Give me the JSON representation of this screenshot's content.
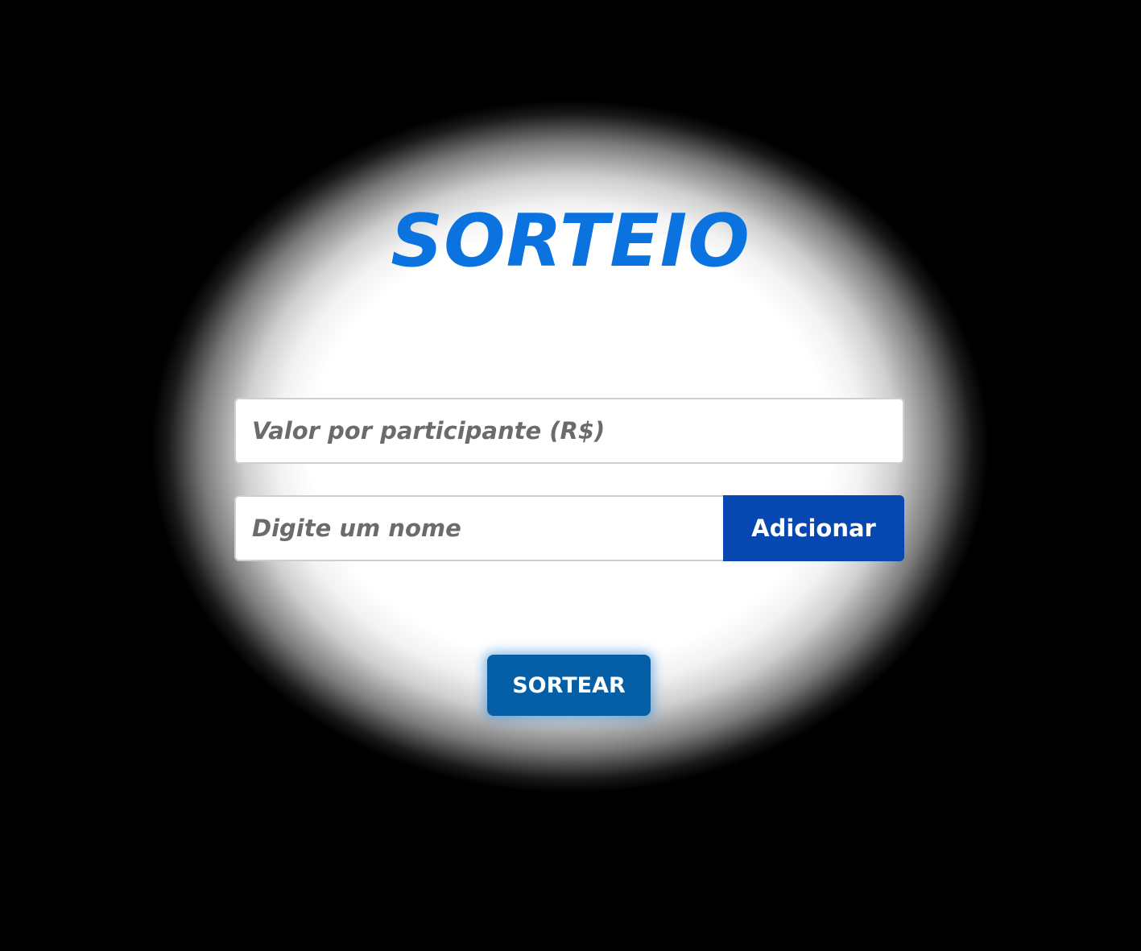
{
  "title": "SORTEIO",
  "form": {
    "valor_placeholder": "Valor por participante (R$)",
    "valor_value": "",
    "nome_placeholder": "Digite um nome",
    "nome_value": "",
    "add_label": "Adicionar"
  },
  "draw_label": "SORTEAR",
  "colors": {
    "title": "#0a73e0",
    "add_button": "#0648b0",
    "draw_button": "#045fa6",
    "background": "#000000"
  }
}
